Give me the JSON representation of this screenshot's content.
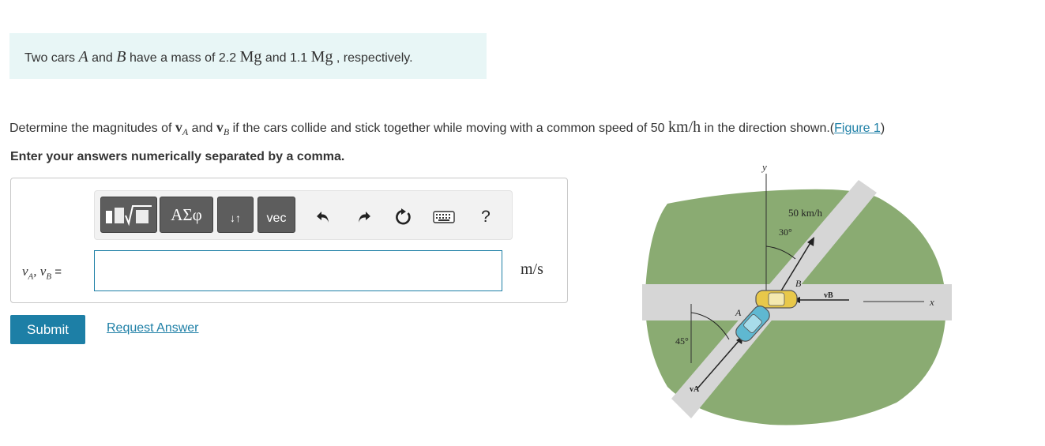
{
  "intro": {
    "prefix": "Two cars ",
    "sym_a": "A",
    "and1": " and ",
    "sym_b": "B",
    "mid": " have a mass of 2.2 ",
    "unit1": "Mg",
    "and2": " and 1.1 ",
    "unit2": "Mg",
    "suffix": " , respectively."
  },
  "question": {
    "p1": "Determine the magnitudes of ",
    "vA_v": "v",
    "vA_sub": "A",
    "p2": " and ",
    "vB_v": "v",
    "vB_sub": "B",
    "p3": " if the cars collide and stick together while moving with a common speed of 50 ",
    "speed_unit": "km/h",
    "p4": " in the direction shown.(",
    "figure_link": "Figure 1",
    "p5": ")"
  },
  "instruction": "Enter your answers numerically separated by a comma.",
  "toolbar": {
    "templates_label": "▮√□",
    "greek_label": "ΑΣφ",
    "arrows_label": "↓↑",
    "vec_label": "vec",
    "help_label": "?"
  },
  "answer": {
    "label_vA": "v",
    "label_vA_sub": "A",
    "label_sep": ", ",
    "label_vB": "v",
    "label_vB_sub": "B",
    "label_eq": " =",
    "value": "",
    "unit": "m/s"
  },
  "buttons": {
    "submit": "Submit",
    "request_answer": "Request Answer"
  },
  "figure": {
    "y_label": "y",
    "x_label": "x",
    "speed_label": "50 km/h",
    "angle_30": "30°",
    "angle_45": "45°",
    "car_a_label": "A",
    "car_b_label": "B",
    "vA_label": "vA",
    "vB_label": "vB"
  },
  "colors": {
    "accent": "#1d7fa6",
    "intro_bg": "#e8f6f6",
    "grass": "#8aab72",
    "road": "#d4d4d4",
    "car_a": "#5fb8d1",
    "car_b": "#e8c84a"
  }
}
